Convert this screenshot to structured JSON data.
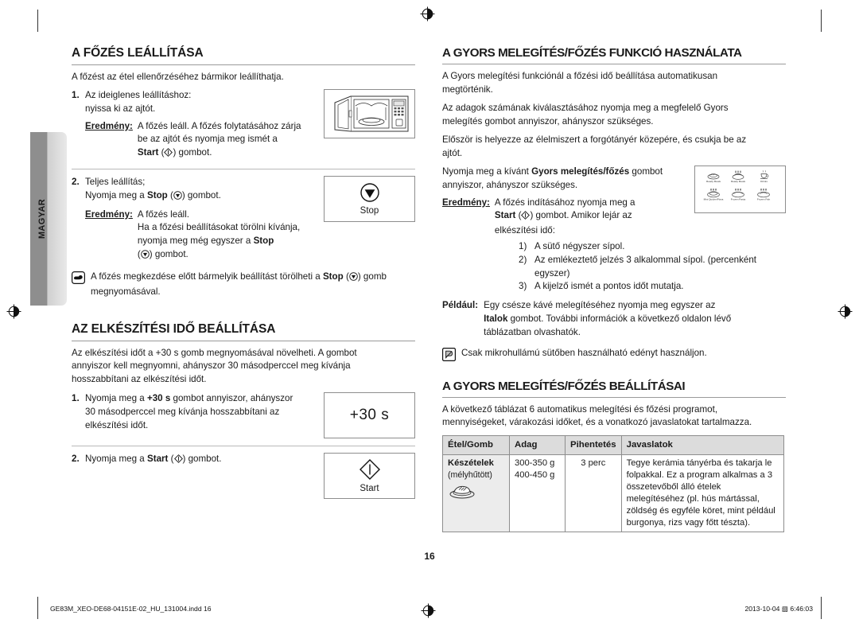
{
  "document": {
    "language_tab": "MAGYAR",
    "page_number": "16"
  },
  "left_column": {
    "section1": {
      "heading": "A FŐZÉS LEÁLLÍTÁSA",
      "intro": "A főzést az étel ellenőrzéséhez bármikor leállíthatja.",
      "step1": {
        "number": "1.",
        "line1": "Az ideiglenes leállításhoz:",
        "line2": "nyissa ki az ajtót.",
        "result_label": "Eredmény:",
        "result_line1": "A főzés leáll. A főzés folytatásához zárja",
        "result_line2": "be az ajtót és nyomja meg ismét a",
        "result_line3_pre": "Start",
        "result_line3_post": ") gombot.",
        "figure": "microwave-open-door"
      },
      "step2": {
        "number": "2.",
        "line1": "Teljes leállítás;",
        "line2_pre": "Nyomja meg a ",
        "line2_bold": "Stop",
        "line2_post": ") gombot.",
        "result_label": "Eredmény:",
        "result_line1": "A főzés leáll.",
        "result_line2": "Ha a főzési beállításokat törölni kívánja,",
        "result_line3_pre": "nyomja meg még egyszer a ",
        "result_line3_bold": "Stop",
        "result_line3_post": ") gombot.",
        "button_caption": "Stop"
      },
      "note": {
        "icon": "pointing-hand-icon",
        "text_pre": "A főzés megkezdése előtt bármelyik beállítást törölheti a ",
        "text_bold": "Stop",
        "text_post": ")",
        "text_line2": "gomb megnyomásával."
      }
    },
    "section2": {
      "heading": "AZ ELKÉSZÍTÉSI IDŐ BEÁLLÍTÁSA",
      "intro_line1": "Az elkészítési időt a +30 s gomb megnyomásával növelheti. A gombot",
      "intro_line2": "annyiszor kell megnyomni, ahányszor 30 másodperccel meg kívánja",
      "intro_line3": "hosszabbítani az elkészítési időt.",
      "step1": {
        "number": "1.",
        "line1_pre": "Nyomja meg a ",
        "line1_bold": "+30 s",
        "line1_post": " gombot annyiszor, ahányszor",
        "line2": "30 másodperccel meg kívánja hosszabbítani az",
        "line3": "elkészítési időt.",
        "button_label": "+30 s"
      },
      "step2": {
        "number": "2.",
        "line1_pre": "Nyomja meg a ",
        "line1_bold": "Start",
        "line1_post": ") gombot.",
        "button_caption": "Start"
      }
    }
  },
  "right_column": {
    "section1": {
      "heading": "A GYORS MELEGÍTÉS/FŐZÉS FUNKCIÓ HASZNÁLATA",
      "para1_line1": "A Gyors melegítési funkciónál a főzési idő beállítása automatikusan",
      "para1_line2": "megtörténik.",
      "para2_line1": "Az adagok számának kiválasztásához nyomja meg a megfelelő Gyors",
      "para2_line2": "melegítés gombot annyiszor, ahányszor szükséges.",
      "para3_line1": "Először is helyezze az élelmiszert a forgótányér közepére, és csukja be az",
      "para3_line2": "ajtót.",
      "press_line1_pre": "Nyomja meg a kívánt ",
      "press_line1_bold": "Gyors melegítés/főzés",
      "press_line1_post": " gombot",
      "press_line2": "annyiszor, ahányszor szükséges.",
      "result_label": "Eredmény:",
      "result_line1": "A főzés indításához nyomja meg a",
      "result_line2_pre": "Start",
      "result_line2_post": ") gombot. Amikor lejár az",
      "result_line3": "elkészítési idő:",
      "sublist": [
        {
          "marker": "1)",
          "text": "A sütő négyszer sípol."
        },
        {
          "marker": "2)",
          "text": "Az emlékeztető jelzés 3 alkalommal sípol. (percenként egyszer)"
        },
        {
          "marker": "3)",
          "text": "A kijelző ismét a pontos időt mutatja."
        }
      ],
      "example_label": "Például:",
      "example_line1": "Egy csésze kávé melegítéséhez nyomja meg egyszer az",
      "example_line2_bold": "Italok",
      "example_line2_post": " gombot. További információk a következő oldalon lévő",
      "example_line3": "táblázatban olvashatók.",
      "note": {
        "icon": "note-pencil-icon",
        "text": "Csak mikrohullámú sütőben használható edényt használjon."
      },
      "icon_panel": {
        "title": "quick-heat-buttons",
        "items": [
          {
            "icon": "ready-meals-icon",
            "label": "Ready Meals"
          },
          {
            "icon": "ready-meals-2-icon",
            "label": "Ready Meals"
          },
          {
            "icon": "drinks-icon",
            "label": "Drinks"
          },
          {
            "icon": "mini-quiche-pizza-icon",
            "label": "Mini Quiche/Pizza"
          },
          {
            "icon": "frozen-pasta-icon",
            "label": "Frozen Pasta"
          },
          {
            "icon": "frozen-fish-icon",
            "label": "Frozen Fish"
          }
        ]
      }
    },
    "section2": {
      "heading": "A GYORS MELEGÍTÉS/FŐZÉS BEÁLLÍTÁSAI",
      "intro_line1": "A következő táblázat 6 automatikus melegítési és főzési programot,",
      "intro_line2": "mennyiségeket, várakozási időket, és a vonatkozó javaslatokat tartalmazza.",
      "table": {
        "headers": [
          "Étel/Gomb",
          "Adag",
          "Pihentetés",
          "Javaslatok"
        ],
        "rows": [
          {
            "food_name": "Készételek",
            "food_sub": "(mélyhűtött)",
            "food_icon": "ready-meal-plate-icon",
            "amount_line1": "300-350 g",
            "amount_line2": "400-450 g",
            "rest": "3 perc",
            "suggestion": "Tegye kerámia tányérba és takarja le folpakkal. Ez a program alkalmas a 3 összetevőből álló ételek melegítéséhez (pl. hús mártással, zöldség és egyféle köret, mint például burgonya, rizs vagy főtt tészta)."
          }
        ]
      }
    }
  },
  "footer": {
    "filename": "GE83M_XEO-DE68-04151E-02_HU_131004.indd   16",
    "timestamp": "2013-10-04   ▧ 6:46:03",
    "registration_mark": "registration-target-icon"
  }
}
